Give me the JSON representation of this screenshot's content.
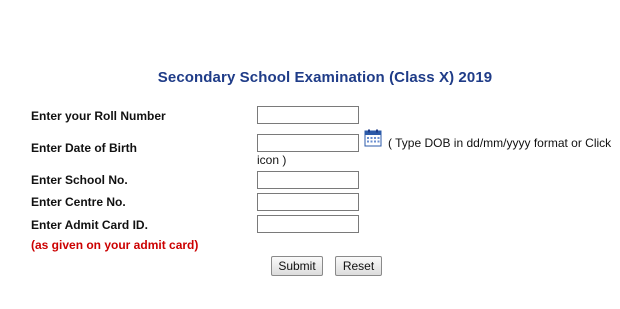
{
  "page_title": "Secondary School Examination (Class X) 2019",
  "form": {
    "roll_label": "Enter your Roll Number",
    "roll_value": "",
    "dob_label": "Enter Date of Birth",
    "dob_value": "",
    "dob_hint_line1": "( Type DOB in dd/mm/yyyy format or Click",
    "dob_hint_line2": "icon )",
    "school_label": "Enter School No.",
    "school_value": "",
    "centre_label": "Enter Centre No.",
    "centre_value": "",
    "admit_label": "Enter Admit Card ID.",
    "admit_value": "",
    "admit_note": "(as given on your admit card)",
    "submit_label": "Submit",
    "reset_label": "Reset"
  },
  "icons": {
    "calendar": "calendar-icon"
  },
  "colors": {
    "title": "#1f3c88",
    "note": "#cc0000"
  }
}
